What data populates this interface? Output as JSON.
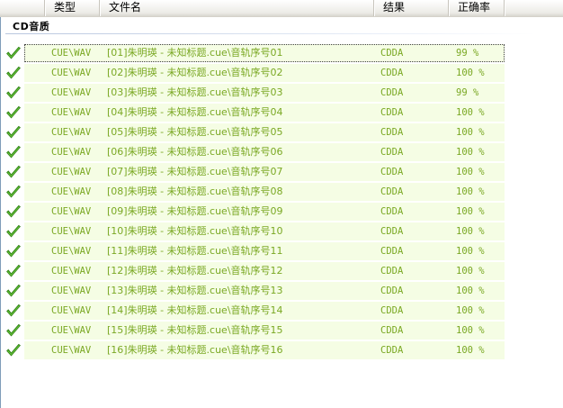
{
  "columns": {
    "type": "类型",
    "filename": "文件名",
    "result": "结果",
    "accuracy": "正确率"
  },
  "group": {
    "label": "CD音质"
  },
  "rows": [
    {
      "type": "CUE\\WAV",
      "filename": "[01]朱明瑛 - 未知标题.cue\\音轨序号01",
      "result": "CDDA",
      "accuracy": "99 %"
    },
    {
      "type": "CUE\\WAV",
      "filename": "[02]朱明瑛 - 未知标题.cue\\音轨序号02",
      "result": "CDDA",
      "accuracy": "100 %"
    },
    {
      "type": "CUE\\WAV",
      "filename": "[03]朱明瑛 - 未知标题.cue\\音轨序号03",
      "result": "CDDA",
      "accuracy": "99 %"
    },
    {
      "type": "CUE\\WAV",
      "filename": "[04]朱明瑛 - 未知标题.cue\\音轨序号04",
      "result": "CDDA",
      "accuracy": "100 %"
    },
    {
      "type": "CUE\\WAV",
      "filename": "[05]朱明瑛 - 未知标题.cue\\音轨序号05",
      "result": "CDDA",
      "accuracy": "100 %"
    },
    {
      "type": "CUE\\WAV",
      "filename": "[06]朱明瑛 - 未知标题.cue\\音轨序号06",
      "result": "CDDA",
      "accuracy": "100 %"
    },
    {
      "type": "CUE\\WAV",
      "filename": "[07]朱明瑛 - 未知标题.cue\\音轨序号07",
      "result": "CDDA",
      "accuracy": "100 %"
    },
    {
      "type": "CUE\\WAV",
      "filename": "[08]朱明瑛 - 未知标题.cue\\音轨序号08",
      "result": "CDDA",
      "accuracy": "100 %"
    },
    {
      "type": "CUE\\WAV",
      "filename": "[09]朱明瑛 - 未知标题.cue\\音轨序号09",
      "result": "CDDA",
      "accuracy": "100 %"
    },
    {
      "type": "CUE\\WAV",
      "filename": "[10]朱明瑛 - 未知标题.cue\\音轨序号10",
      "result": "CDDA",
      "accuracy": "100 %"
    },
    {
      "type": "CUE\\WAV",
      "filename": "[11]朱明瑛 - 未知标题.cue\\音轨序号11",
      "result": "CDDA",
      "accuracy": "100 %"
    },
    {
      "type": "CUE\\WAV",
      "filename": "[12]朱明瑛 - 未知标题.cue\\音轨序号12",
      "result": "CDDA",
      "accuracy": "100 %"
    },
    {
      "type": "CUE\\WAV",
      "filename": "[13]朱明瑛 - 未知标题.cue\\音轨序号13",
      "result": "CDDA",
      "accuracy": "100 %"
    },
    {
      "type": "CUE\\WAV",
      "filename": "[14]朱明瑛 - 未知标题.cue\\音轨序号14",
      "result": "CDDA",
      "accuracy": "100 %"
    },
    {
      "type": "CUE\\WAV",
      "filename": "[15]朱明瑛 - 未知标题.cue\\音轨序号15",
      "result": "CDDA",
      "accuracy": "100 %"
    },
    {
      "type": "CUE\\WAV",
      "filename": "[16]朱明瑛 - 未知标题.cue\\音轨序号16",
      "result": "CDDA",
      "accuracy": "100 %"
    }
  ],
  "row_status_icon": "checkmark-icon",
  "colors": {
    "row_text": "#7aa823",
    "row_background": "#f5fde4",
    "check_green": "#3a9a1c"
  }
}
